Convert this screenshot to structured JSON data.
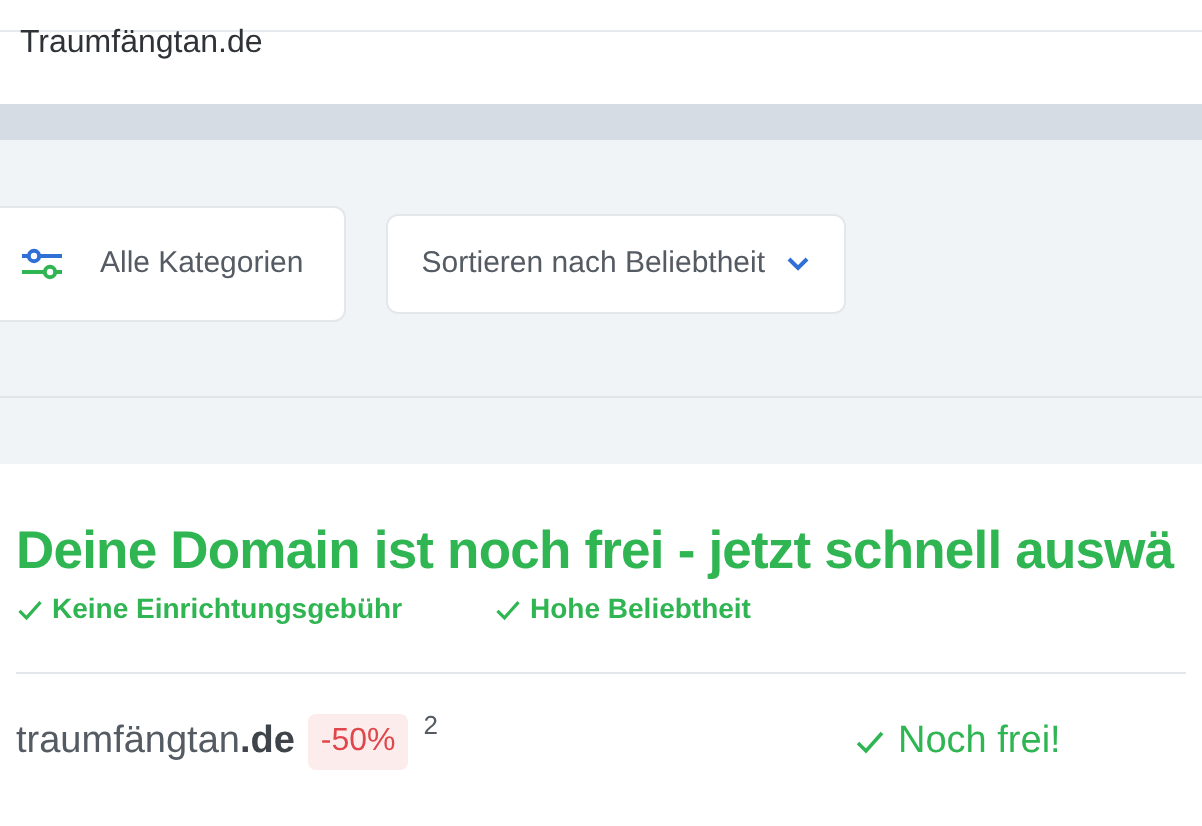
{
  "search": {
    "value": "Traumfängtan.de"
  },
  "filters": [
    {
      "kind": "category",
      "label": "Alle Kategorien"
    },
    {
      "kind": "sort",
      "label": "Sortieren nach Beliebtheit"
    }
  ],
  "headline": "Deine Domain ist noch frei - jetzt schnell auswä",
  "features": [
    "Keine Einrichtungsgebühr",
    "Hohe Beliebtheit"
  ],
  "results": [
    {
      "domain": "traumfängtan**.de**",
      "discount": "-50%",
      "footnote": "2",
      "status": "Noch frei!"
    }
  ]
}
